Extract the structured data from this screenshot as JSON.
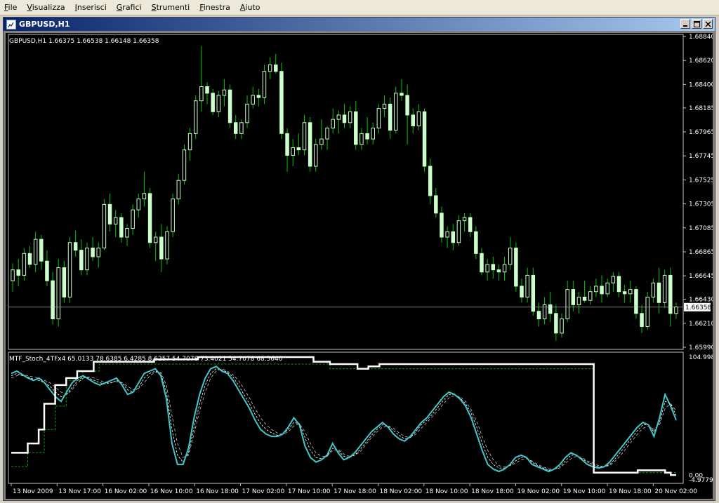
{
  "menu": [
    "File",
    "Visualizza",
    "Inserisci",
    "Grafici",
    "Strumenti",
    "Finestra",
    "Aiuto"
  ],
  "window": {
    "title": "GBPUSD,H1"
  },
  "colors": {
    "bg": "#000000",
    "frame": "#c0c0c0",
    "up": "#ccffcc",
    "down": "#ccffcc",
    "wick": "#00c800",
    "stoch": "#40c8c8",
    "white": "#ffffff",
    "green": "#00a000",
    "bidline": "#c0c0c0"
  },
  "main_chart": {
    "header": "GBPUSD,H1  1.66375 1.66538 1.66148 1.66358",
    "price_labels": [
      "1.68840",
      "1.68620",
      "1.68400",
      "1.68185",
      "1.67965",
      "1.67745",
      "1.67525",
      "1.67305",
      "1.67085",
      "1.66865",
      "1.66645",
      "1.66430",
      "1.66210",
      "1.65990"
    ],
    "ylim": [
      1.6599,
      1.6884
    ],
    "bid_label": "1.66358",
    "bid": 1.66358
  },
  "chart_data": {
    "type": "candlestick",
    "symbol": "GBPUSD",
    "timeframe": "H1",
    "ohlc": [
      [
        1.666,
        1.6676,
        1.665,
        1.667
      ],
      [
        1.667,
        1.668,
        1.6655,
        1.6665
      ],
      [
        1.6665,
        1.669,
        1.666,
        1.6685
      ],
      [
        1.6685,
        1.6692,
        1.6672,
        1.6675
      ],
      [
        1.6675,
        1.6705,
        1.6668,
        1.6698
      ],
      [
        1.6698,
        1.6702,
        1.667,
        1.6678
      ],
      [
        1.6678,
        1.6688,
        1.6655,
        1.666
      ],
      [
        1.666,
        1.6668,
        1.662,
        1.6625
      ],
      [
        1.6625,
        1.668,
        1.6618,
        1.6672
      ],
      [
        1.6672,
        1.6678,
        1.664,
        1.6645
      ],
      [
        1.6645,
        1.67,
        1.664,
        1.6695
      ],
      [
        1.6695,
        1.6706,
        1.6682,
        1.6688
      ],
      [
        1.6688,
        1.6698,
        1.6665,
        1.667
      ],
      [
        1.667,
        1.6695,
        1.6665,
        1.669
      ],
      [
        1.669,
        1.67,
        1.6678,
        1.6682
      ],
      [
        1.6682,
        1.6695,
        1.6672,
        1.669
      ],
      [
        1.669,
        1.6735,
        1.6688,
        1.673
      ],
      [
        1.673,
        1.674,
        1.6705,
        1.6712
      ],
      [
        1.6712,
        1.6725,
        1.67,
        1.6718
      ],
      [
        1.6718,
        1.6722,
        1.6695,
        1.67
      ],
      [
        1.67,
        1.6712,
        1.6692,
        1.6708
      ],
      [
        1.6708,
        1.673,
        1.6702,
        1.6725
      ],
      [
        1.6725,
        1.674,
        1.6718,
        1.6735
      ],
      [
        1.6735,
        1.676,
        1.6728,
        1.674
      ],
      [
        1.674,
        1.6745,
        1.669,
        1.6695
      ],
      [
        1.6695,
        1.6705,
        1.6678,
        1.67
      ],
      [
        1.67,
        1.6712,
        1.6668,
        1.668
      ],
      [
        1.668,
        1.671,
        1.6675,
        1.6705
      ],
      [
        1.6705,
        1.674,
        1.67,
        1.6735
      ],
      [
        1.6735,
        1.6758,
        1.673,
        1.6752
      ],
      [
        1.6752,
        1.6785,
        1.6748,
        1.678
      ],
      [
        1.678,
        1.68,
        1.677,
        1.6795
      ],
      [
        1.6795,
        1.683,
        1.679,
        1.6825
      ],
      [
        1.6825,
        1.6875,
        1.6815,
        1.6838
      ],
      [
        1.6838,
        1.6842,
        1.6822,
        1.6832
      ],
      [
        1.6832,
        1.6836,
        1.6812,
        1.6815
      ],
      [
        1.6815,
        1.6834,
        1.681,
        1.683
      ],
      [
        1.683,
        1.6845,
        1.682,
        1.6835
      ],
      [
        1.6835,
        1.684,
        1.68,
        1.6805
      ],
      [
        1.6805,
        1.6812,
        1.679,
        1.6795
      ],
      [
        1.6795,
        1.6808,
        1.679,
        1.6805
      ],
      [
        1.6805,
        1.683,
        1.68,
        1.6822
      ],
      [
        1.6822,
        1.6838,
        1.6818,
        1.683
      ],
      [
        1.683,
        1.6836,
        1.682,
        1.6828
      ],
      [
        1.6828,
        1.6858,
        1.6822,
        1.6852
      ],
      [
        1.6852,
        1.6865,
        1.6845,
        1.6858
      ],
      [
        1.6858,
        1.6868,
        1.685,
        1.6852
      ],
      [
        1.6852,
        1.686,
        1.679,
        1.6795
      ],
      [
        1.6795,
        1.68,
        1.676,
        1.6775
      ],
      [
        1.6775,
        1.679,
        1.6765,
        1.6782
      ],
      [
        1.6782,
        1.6795,
        1.6775,
        1.678
      ],
      [
        1.678,
        1.6812,
        1.6775,
        1.6805
      ],
      [
        1.6805,
        1.681,
        1.676,
        1.6765
      ],
      [
        1.6765,
        1.679,
        1.676,
        1.6785
      ],
      [
        1.6785,
        1.6808,
        1.678,
        1.679
      ],
      [
        1.679,
        1.6802,
        1.678,
        1.68
      ],
      [
        1.68,
        1.6818,
        1.6795,
        1.6808
      ],
      [
        1.6808,
        1.6816,
        1.6795,
        1.6812
      ],
      [
        1.6812,
        1.6822,
        1.68,
        1.6805
      ],
      [
        1.6805,
        1.682,
        1.68,
        1.6815
      ],
      [
        1.6815,
        1.6825,
        1.678,
        1.6785
      ],
      [
        1.6785,
        1.68,
        1.678,
        1.6795
      ],
      [
        1.6795,
        1.681,
        1.6785,
        1.679
      ],
      [
        1.679,
        1.6805,
        1.6785,
        1.68
      ],
      [
        1.68,
        1.6822,
        1.6795,
        1.6818
      ],
      [
        1.6818,
        1.683,
        1.681,
        1.6822
      ],
      [
        1.6822,
        1.6828,
        1.679,
        1.6798
      ],
      [
        1.6798,
        1.6838,
        1.6795,
        1.6832
      ],
      [
        1.6832,
        1.6845,
        1.6825,
        1.683
      ],
      [
        1.683,
        1.684,
        1.6785,
        1.6812
      ],
      [
        1.6812,
        1.6818,
        1.6795,
        1.6802
      ],
      [
        1.6802,
        1.6822,
        1.6798,
        1.6815
      ],
      [
        1.6815,
        1.6818,
        1.676,
        1.6765
      ],
      [
        1.6765,
        1.6772,
        1.673,
        1.6738
      ],
      [
        1.6738,
        1.6745,
        1.6718,
        1.6722
      ],
      [
        1.6722,
        1.6728,
        1.6695,
        1.67
      ],
      [
        1.67,
        1.671,
        1.669,
        1.6705
      ],
      [
        1.6705,
        1.6712,
        1.6688,
        1.6695
      ],
      [
        1.6695,
        1.672,
        1.6692,
        1.6715
      ],
      [
        1.6715,
        1.6722,
        1.6705,
        1.6718
      ],
      [
        1.6718,
        1.6722,
        1.67,
        1.6705
      ],
      [
        1.6705,
        1.671,
        1.668,
        1.6685
      ],
      [
        1.6685,
        1.669,
        1.6665,
        1.6668
      ],
      [
        1.6668,
        1.668,
        1.666,
        1.6675
      ],
      [
        1.6675,
        1.6682,
        1.6662,
        1.667
      ],
      [
        1.667,
        1.6675,
        1.666,
        1.6668
      ],
      [
        1.6668,
        1.6682,
        1.666,
        1.6675
      ],
      [
        1.6675,
        1.67,
        1.667,
        1.669
      ],
      [
        1.669,
        1.6695,
        1.665,
        1.6655
      ],
      [
        1.6655,
        1.6662,
        1.664,
        1.6645
      ],
      [
        1.6645,
        1.6672,
        1.664,
        1.6665
      ],
      [
        1.6665,
        1.6672,
        1.6628,
        1.6632
      ],
      [
        1.6632,
        1.664,
        1.6618,
        1.6625
      ],
      [
        1.6625,
        1.6645,
        1.662,
        1.6638
      ],
      [
        1.6638,
        1.665,
        1.6622,
        1.663
      ],
      [
        1.663,
        1.6638,
        1.6605,
        1.6612
      ],
      [
        1.6612,
        1.663,
        1.6608,
        1.6625
      ],
      [
        1.6625,
        1.666,
        1.6622,
        1.6652
      ],
      [
        1.6652,
        1.666,
        1.6632,
        1.6638
      ],
      [
        1.6638,
        1.665,
        1.663,
        1.6645
      ],
      [
        1.6645,
        1.666,
        1.664,
        1.6642
      ],
      [
        1.6642,
        1.6655,
        1.6638,
        1.665
      ],
      [
        1.665,
        1.6662,
        1.6645,
        1.6655
      ],
      [
        1.6655,
        1.6665,
        1.664,
        1.6648
      ],
      [
        1.6648,
        1.6662,
        1.6645,
        1.6658
      ],
      [
        1.6658,
        1.6668,
        1.665,
        1.6664
      ],
      [
        1.6664,
        1.6668,
        1.6645,
        1.665
      ],
      [
        1.665,
        1.6656,
        1.664,
        1.6648
      ],
      [
        1.6648,
        1.666,
        1.664,
        1.6652
      ],
      [
        1.6652,
        1.6655,
        1.6625,
        1.663
      ],
      [
        1.663,
        1.6638,
        1.6612,
        1.6618
      ],
      [
        1.6618,
        1.665,
        1.6615,
        1.6645
      ],
      [
        1.6645,
        1.6662,
        1.664,
        1.6658
      ],
      [
        1.6658,
        1.6672,
        1.663,
        1.664
      ],
      [
        1.664,
        1.667,
        1.6635,
        1.6665
      ],
      [
        1.6665,
        1.6672,
        1.6618,
        1.663
      ],
      [
        1.663,
        1.664,
        1.6625,
        1.6636
      ]
    ]
  },
  "indicator": {
    "header": "MTF_Stoch_4TFx4 65.0133 78.6385 6.4285 8.6257 54.7078 73.4021 54.7078 68.5640",
    "top_label": "104.9989",
    "mid_label": "0.00",
    "bottom_label": "-4.9779",
    "ylim": [
      -4.9779,
      104.9989
    ],
    "series": {
      "main": [
        88,
        90,
        87,
        84,
        82,
        84,
        80,
        74,
        68,
        64,
        72,
        80,
        84,
        86,
        83,
        80,
        78,
        80,
        82,
        84,
        78,
        70,
        72,
        80,
        88,
        90,
        92,
        86,
        66,
        28,
        10,
        10,
        24,
        50,
        70,
        84,
        92,
        94,
        90,
        88,
        82,
        74,
        66,
        58,
        48,
        40,
        36,
        34,
        34,
        36,
        42,
        50,
        44,
        26,
        16,
        12,
        14,
        18,
        28,
        20,
        14,
        16,
        20,
        26,
        32,
        38,
        42,
        46,
        42,
        36,
        32,
        30,
        34,
        40,
        46,
        50,
        56,
        62,
        68,
        72,
        70,
        66,
        60,
        50,
        36,
        22,
        10,
        6,
        4,
        6,
        10,
        16,
        18,
        16,
        10,
        8,
        6,
        4,
        6,
        10,
        16,
        20,
        18,
        14,
        10,
        8,
        7,
        8,
        12,
        18,
        24,
        30,
        36,
        42,
        46,
        44,
        34,
        50,
        70,
        60,
        48
      ],
      "signal": [
        86,
        88,
        86,
        85,
        83,
        82,
        80,
        77,
        72,
        68,
        70,
        76,
        82,
        85,
        84,
        82,
        80,
        79,
        80,
        82,
        80,
        74,
        72,
        76,
        84,
        88,
        90,
        88,
        72,
        40,
        18,
        12,
        20,
        42,
        62,
        78,
        88,
        92,
        91,
        89,
        85,
        78,
        70,
        62,
        53,
        45,
        40,
        37,
        35,
        36,
        40,
        46,
        45,
        33,
        22,
        16,
        15,
        17,
        24,
        22,
        17,
        16,
        18,
        23,
        29,
        35,
        40,
        44,
        43,
        39,
        35,
        32,
        33,
        38,
        44,
        48,
        53,
        59,
        65,
        70,
        70,
        67,
        62,
        54,
        42,
        28,
        16,
        10,
        7,
        7,
        9,
        13,
        16,
        16,
        12,
        9,
        7,
        5,
        6,
        8,
        13,
        18,
        18,
        15,
        12,
        10,
        8,
        8,
        10,
        15,
        21,
        27,
        33,
        39,
        44,
        44,
        38,
        46,
        64,
        62,
        52
      ],
      "signal2": [
        84,
        86,
        87,
        86,
        85,
        84,
        82,
        80,
        76,
        72,
        70,
        74,
        80,
        84,
        85,
        84,
        82,
        80,
        80,
        81,
        80,
        77,
        74,
        75,
        80,
        86,
        89,
        89,
        78,
        52,
        28,
        16,
        18,
        36,
        56,
        72,
        84,
        90,
        92,
        90,
        87,
        82,
        75,
        67,
        58,
        50,
        44,
        40,
        37,
        36,
        38,
        43,
        45,
        38,
        28,
        20,
        17,
        17,
        22,
        23,
        19,
        17,
        18,
        21,
        27,
        33,
        38,
        42,
        43,
        41,
        37,
        34,
        33,
        36,
        41,
        46,
        51,
        56,
        62,
        67,
        69,
        68,
        64,
        57,
        47,
        34,
        22,
        14,
        9,
        8,
        9,
        11,
        14,
        15,
        13,
        10,
        8,
        6,
        6,
        7,
        11,
        15,
        17,
        16,
        13,
        11,
        9,
        8,
        9,
        13,
        18,
        24,
        30,
        36,
        41,
        43,
        40,
        44,
        58,
        62,
        56
      ],
      "white_tf": [
        20,
        20,
        20,
        28,
        28,
        40,
        62,
        62,
        78,
        78,
        84,
        84,
        90,
        90,
        90,
        98,
        98,
        98,
        98,
        98,
        98,
        98,
        98,
        98,
        98,
        98,
        100,
        100,
        100,
        100,
        100,
        100,
        100,
        100,
        102,
        102,
        102,
        102,
        102,
        102,
        102,
        102,
        102,
        102,
        102,
        102,
        102,
        102,
        102,
        102,
        102,
        102,
        102,
        102,
        102,
        98,
        98,
        98,
        96,
        96,
        96,
        96,
        96,
        92,
        92,
        94,
        94,
        96,
        96,
        96,
        96,
        96,
        96,
        96,
        96,
        96,
        96,
        96,
        96,
        96,
        96,
        96,
        96,
        96,
        96,
        96,
        96,
        96,
        96,
        96,
        96,
        96,
        96,
        96,
        96,
        96,
        96,
        96,
        96,
        96,
        96,
        96,
        96,
        96,
        96,
        96,
        3,
        3,
        3,
        3,
        3,
        3,
        3,
        3,
        5,
        5,
        5,
        5,
        5,
        3,
        1,
        1
      ],
      "green_tf": [
        8,
        8,
        8,
        20,
        20,
        20,
        40,
        40,
        60,
        60,
        82,
        82,
        82,
        90,
        90,
        90,
        96,
        96,
        96,
        96,
        96,
        96,
        96,
        96,
        96,
        96,
        96,
        96,
        96,
        96,
        96,
        96,
        96,
        96,
        96,
        96,
        96,
        96,
        96,
        96,
        96,
        96,
        96,
        96,
        96,
        96,
        96,
        96,
        96,
        96,
        96,
        96,
        96,
        96,
        96,
        96,
        96,
        96,
        92,
        92,
        92,
        92,
        92,
        92,
        92,
        92,
        92,
        92,
        92,
        92,
        92,
        92,
        92,
        92,
        92,
        92,
        92,
        92,
        92,
        92,
        92,
        92,
        92,
        92,
        92,
        92,
        92,
        92,
        92,
        92,
        92,
        92,
        92,
        92,
        92,
        92,
        92,
        92,
        92,
        92,
        92,
        92,
        92,
        92,
        92,
        92,
        3,
        3,
        3,
        3,
        3,
        3,
        3,
        3,
        3,
        3,
        3,
        3,
        3,
        3,
        3,
        3
      ]
    }
  },
  "time_labels": [
    "13 Nov 2009",
    "13 Nov 17:00",
    "16 Nov 02:00",
    "16 Nov 10:00",
    "16 Nov 18:00",
    "17 Nov 02:00",
    "17 Nov 10:00",
    "17 Nov 18:00",
    "18 Nov 02:00",
    "18 Nov 10:00",
    "18 Nov 18:00",
    "19 Nov 02:00",
    "19 Nov 10:00",
    "19 Nov 18:00",
    "20 Nov 02:00"
  ]
}
